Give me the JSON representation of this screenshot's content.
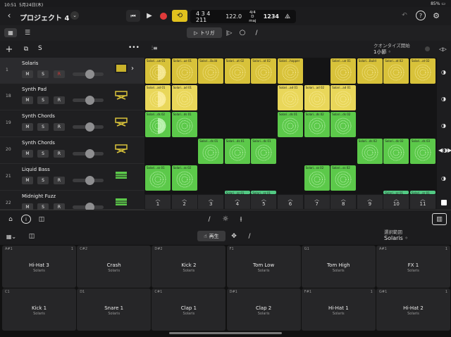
{
  "status": {
    "time": "10:51",
    "date": "5月24日(木)",
    "battery": "85%"
  },
  "header": {
    "project": "プロジェクト 4",
    "position": "4 3 4 211",
    "tempo": "122.0",
    "signature": "4/4",
    "key": "D maj",
    "count_in": "1234"
  },
  "toolbar": {
    "trigger_label": "トリガ"
  },
  "quantize": {
    "label": "クオンタイズ開始",
    "value": "1小節"
  },
  "tracks_hdr": {
    "solo_label": "S"
  },
  "tracks": [
    {
      "num": "1",
      "name": "Solaris",
      "m": "M",
      "s": "S",
      "r": "R"
    },
    {
      "num": "18",
      "name": "Synth Pad",
      "m": "M",
      "s": "S",
      "r": "R"
    },
    {
      "num": "19",
      "name": "Synth Chords",
      "m": "M",
      "s": "S",
      "r": "R"
    },
    {
      "num": "20",
      "name": "Synth Chords",
      "m": "M",
      "s": "S",
      "r": "R"
    },
    {
      "num": "21",
      "name": "Liquid Bass",
      "m": "M",
      "s": "S",
      "r": "R"
    },
    {
      "num": "22",
      "name": "Midnight Fuzz",
      "m": "M",
      "s": "S",
      "r": "R"
    }
  ],
  "cells": [
    {
      "label": "Solari...ue 01"
    },
    {
      "label": "Solari...ue 01"
    },
    {
      "label": "Solari...Build"
    },
    {
      "label": "Solari...at 02"
    },
    {
      "label": "Solari...at 02"
    },
    {
      "label": "Solari...hopper"
    },
    {
      "label": "Solari...ue 01"
    },
    {
      "label": "Solari...Build"
    },
    {
      "label": "Solari...at 02"
    },
    {
      "label": "Solari...at 02"
    },
    {
      "label": "Solari...ad 01"
    },
    {
      "label": "Solari...ad 01"
    },
    {
      "label": "Solari...ad 01"
    },
    {
      "label": "Solari...ad 02"
    },
    {
      "label": "Solari...ad 01"
    },
    {
      "label": "Solari...ds 02"
    },
    {
      "label": "Solari...ds 01"
    },
    {
      "label": "Solari...ds 01"
    },
    {
      "label": "Solari...ds 02"
    },
    {
      "label": "Solari...ds 02"
    },
    {
      "label": "Solari...ds 01"
    },
    {
      "label": "Solari...ds 01"
    },
    {
      "label": "Solari...ds 01"
    },
    {
      "label": "Solari...ds 02"
    },
    {
      "label": "Solari...ds 02"
    },
    {
      "label": "Solari...ds 03"
    },
    {
      "label": "Solari...ss 01"
    },
    {
      "label": "Solari...ss 02"
    },
    {
      "label": "Solari...ss 02"
    },
    {
      "label": "Solari...ss 02"
    },
    {
      "label": "Solari...zz 01"
    },
    {
      "label": "Solari...zz 01"
    },
    {
      "label": "Solari...zz 01"
    },
    {
      "label": "Solari...zz 01"
    }
  ],
  "columns": [
    "1",
    "2",
    "3",
    "4",
    "5",
    "6",
    "7",
    "8",
    "9",
    "10",
    "11"
  ],
  "pads_toolbar": {
    "play_label": "再生",
    "range_label": "選択範囲",
    "range_value": "Solaris"
  },
  "pads": [
    {
      "note": "A#1",
      "num": "1",
      "name": "Hi-Hat 3",
      "kit": "Solaris"
    },
    {
      "note": "C#2",
      "num": "",
      "name": "Crash",
      "kit": "Solaris"
    },
    {
      "note": "D#2",
      "num": "",
      "name": "Kick 2",
      "kit": "Solaris"
    },
    {
      "note": "F1",
      "num": "",
      "name": "Tom Low",
      "kit": "Solaris"
    },
    {
      "note": "G1",
      "num": "",
      "name": "Tom High",
      "kit": "Solaris"
    },
    {
      "note": "A#1",
      "num": "1",
      "name": "FX 1",
      "kit": "Solaris"
    },
    {
      "note": "C1",
      "num": "",
      "name": "Kick 1",
      "kit": "Solaris"
    },
    {
      "note": "D1",
      "num": "",
      "name": "Snare 1",
      "kit": "Solaris"
    },
    {
      "note": "C#1",
      "num": "",
      "name": "Clap 1",
      "kit": "Solaris"
    },
    {
      "note": "D#1",
      "num": "",
      "name": "Clap 2",
      "kit": "Solaris"
    },
    {
      "note": "F#1",
      "num": "1",
      "name": "Hi-Hat 1",
      "kit": "Solaris"
    },
    {
      "note": "G#1",
      "num": "1",
      "name": "Hi-Hat 2",
      "kit": "Solaris"
    }
  ],
  "colors": {
    "yellow": "#d8c23a",
    "yellow_light": "#e9d75a",
    "green": "#5cc94a",
    "teal": "#52c983",
    "record": "#e03a3a",
    "loop": "#e2c21e"
  }
}
